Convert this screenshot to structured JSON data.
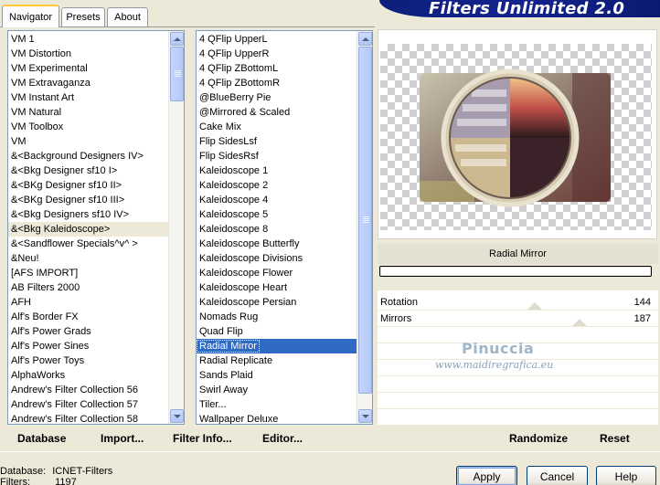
{
  "header": {
    "app_title": "Filters Unlimited 2.0"
  },
  "tabs": [
    {
      "label": "Navigator",
      "active": true
    },
    {
      "label": "Presets",
      "active": false
    },
    {
      "label": "About",
      "active": false
    }
  ],
  "categories": {
    "items": [
      "VM 1",
      "VM Distortion",
      "VM Experimental",
      "VM Extravaganza",
      "VM Instant Art",
      "VM Natural",
      "VM Toolbox",
      "VM",
      "&<Background Designers IV>",
      "&<Bkg Designer sf10 I>",
      "&<BKg Designer sf10 II>",
      "&<BKg Designer sf10 III>",
      "&<Bkg Designers sf10 IV>",
      "&<Bkg Kaleidoscope>",
      "&<Sandflower Specials^v^ >",
      "&Neu!",
      "[AFS IMPORT]",
      "AB Filters 2000",
      "AFH",
      "Alf's Border FX",
      "Alf's Power Grads",
      "Alf's Power Sines",
      "Alf's Power Toys",
      "AlphaWorks",
      "Andrew's Filter Collection 56",
      "Andrew's Filter Collection 57",
      "Andrew's Filter Collection 58"
    ],
    "highlighted": "&<Bkg Kaleidoscope>"
  },
  "filters": {
    "items": [
      "4 QFlip UpperL",
      "4 QFlip UpperR",
      "4 QFlip ZBottomL",
      "4 QFlip ZBottomR",
      "@BlueBerry Pie",
      "@Mirrored & Scaled",
      "Cake Mix",
      "Flip SidesLsf",
      "Flip SidesRsf",
      "Kaleidoscope 1",
      "Kaleidoscope 2",
      "Kaleidoscope 4",
      "Kaleidoscope 5",
      "Kaleidoscope 8",
      "Kaleidoscope Butterfly",
      "Kaleidoscope Divisions",
      "Kaleidoscope Flower",
      "Kaleidoscope Heart",
      "Kaleidoscope Persian",
      "Nomads Rug",
      "Quad Flip",
      "Radial Mirror",
      "Radial Replicate",
      "Sands Plaid",
      "Swirl Away",
      "Tiler...",
      "Wallpaper Deluxe"
    ],
    "selected": "Radial Mirror"
  },
  "preview": {
    "filter_name": "Radial Mirror",
    "progress": 0
  },
  "params": [
    {
      "label": "Rotation",
      "value": "144",
      "level": 144
    },
    {
      "label": "Mirrors",
      "value": "187",
      "level": 187
    }
  ],
  "watermark": {
    "name": "Pinuccia",
    "site": "www.maidiregrafica.eu"
  },
  "toolbar": {
    "database": "Database",
    "import": "Import...",
    "filter_info": "Filter Info...",
    "editor": "Editor...",
    "randomize": "Randomize",
    "reset": "Reset"
  },
  "status": {
    "database_label": "Database:",
    "database_value": "ICNET-Filters",
    "filters_label": "Filters:",
    "filters_value": "1197"
  },
  "buttons": {
    "apply": "Apply",
    "cancel": "Cancel",
    "help": "Help"
  },
  "colors": {
    "accent_blue": "#0b1f7a",
    "selection": "#316ac5",
    "window_bg": "#ece9d8"
  }
}
